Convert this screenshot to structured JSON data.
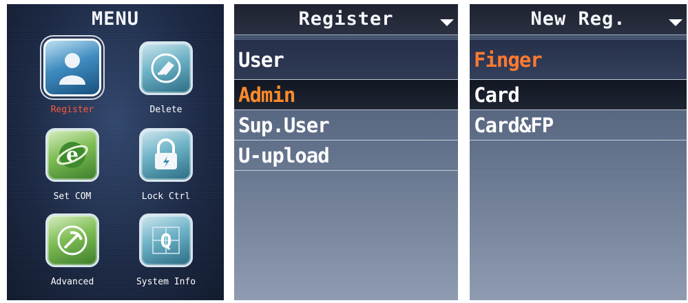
{
  "menu_panel": {
    "title": "MENU",
    "items": [
      {
        "label": "Register",
        "icon": "user-silhouette-icon",
        "selected": true
      },
      {
        "label": "Delete",
        "icon": "eraser-icon",
        "selected": false
      },
      {
        "label": "Set COM",
        "icon": "globe-e-icon",
        "selected": false
      },
      {
        "label": "Lock Ctrl",
        "icon": "padlock-icon",
        "selected": false
      },
      {
        "label": "Advanced",
        "icon": "pickaxe-icon",
        "selected": false
      },
      {
        "label": "System Info",
        "icon": "q-grid-icon",
        "selected": false
      }
    ],
    "colors": {
      "selected_label": "#ff5a3a",
      "label": "#ffffff"
    }
  },
  "register_panel": {
    "title": "Register",
    "items": [
      {
        "label": "User",
        "selected": false
      },
      {
        "label": "Admin",
        "selected": true
      },
      {
        "label": "Sup.User",
        "selected": false
      },
      {
        "label": "U-upload",
        "selected": false
      }
    ],
    "highlight_color": "#ff8a2a"
  },
  "newreg_panel": {
    "title": "New Reg.",
    "items": [
      {
        "label": "Finger",
        "selected": true
      },
      {
        "label": "Card",
        "selected": false
      },
      {
        "label": "Card&FP",
        "selected": false
      }
    ],
    "highlight_color": "#ff7a30"
  }
}
